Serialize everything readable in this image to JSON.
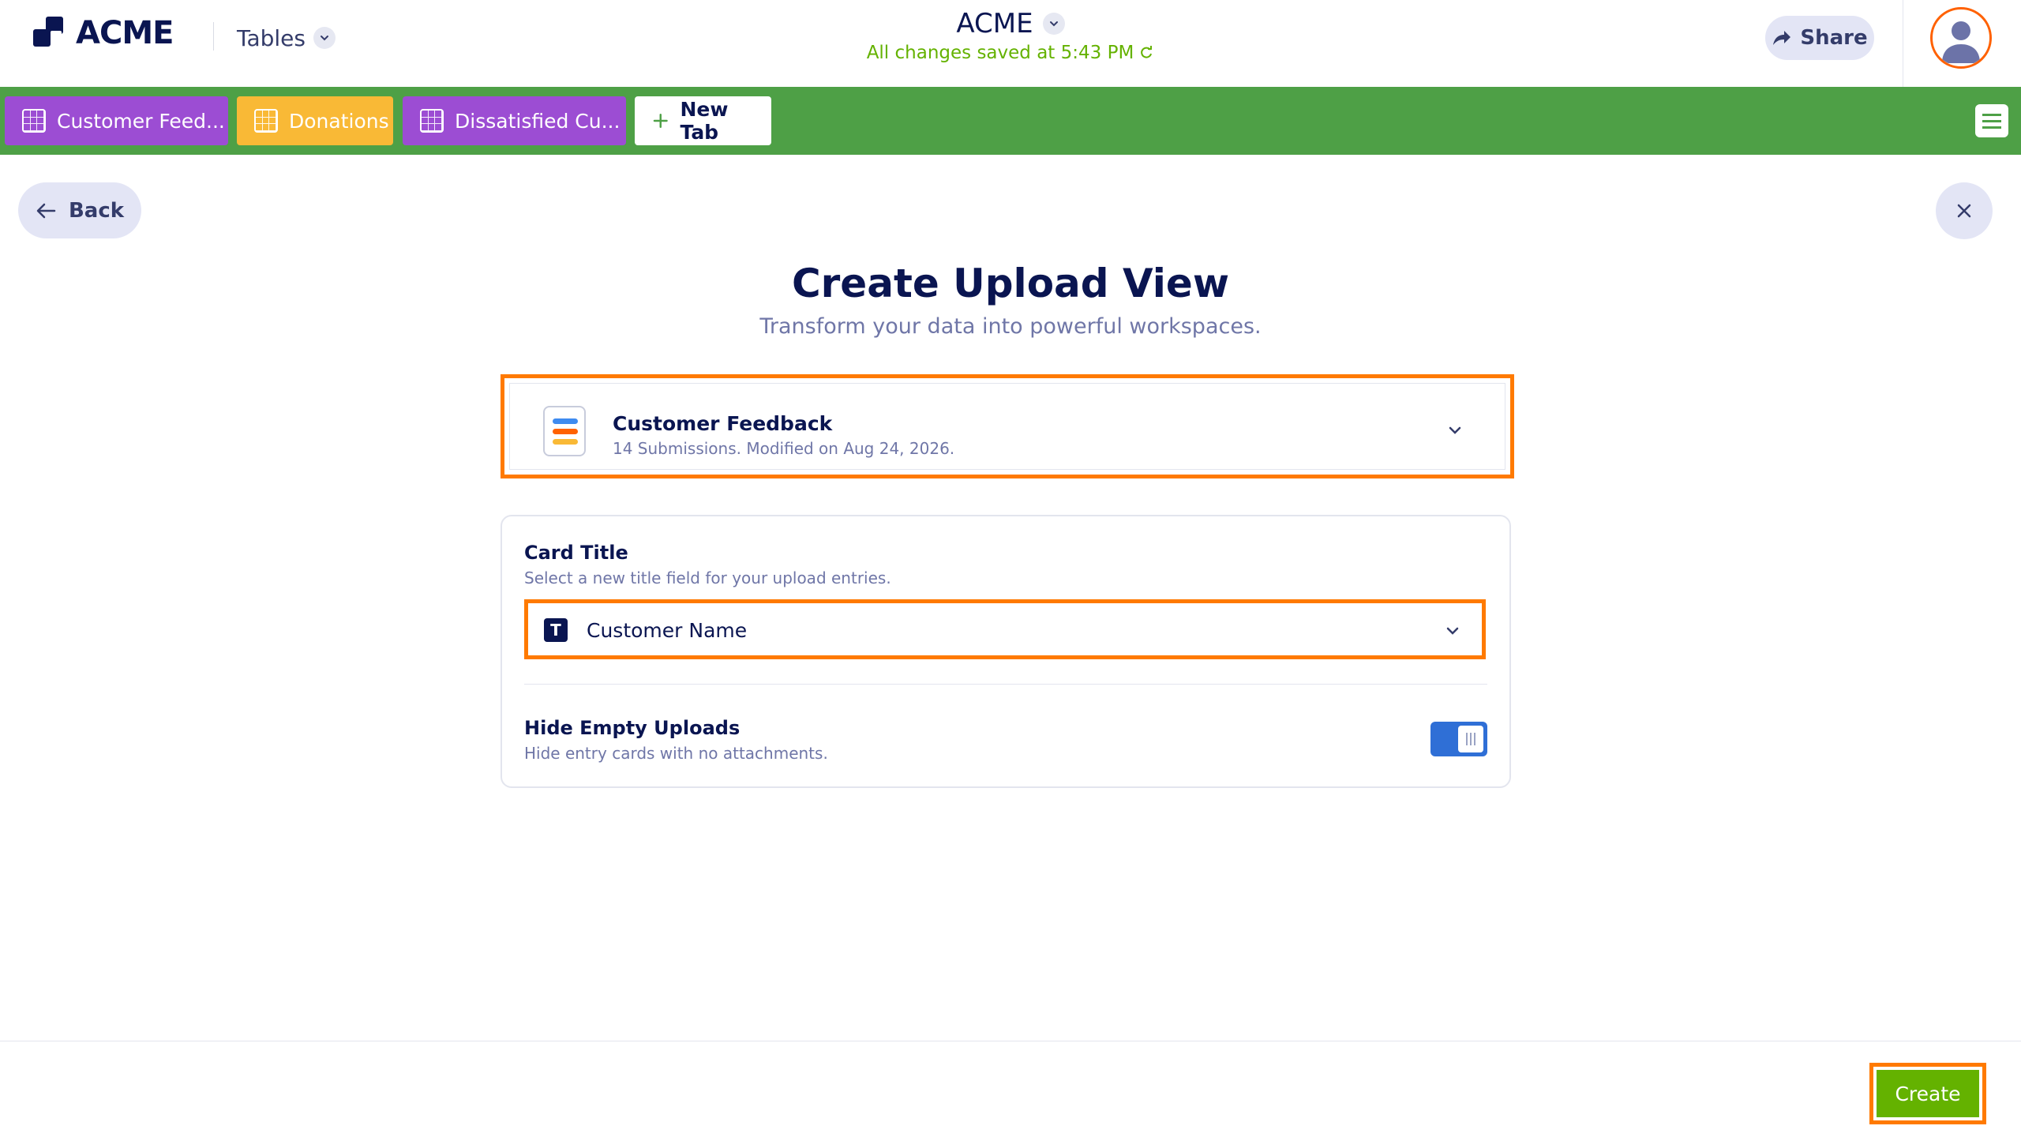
{
  "header": {
    "logo_text": "ACME",
    "product_menu": "Tables",
    "app_title": "ACME",
    "save_status": "All changes saved at 5:43 PM",
    "share_label": "Share"
  },
  "tabs": [
    {
      "label": "Customer Feed...",
      "color": "#9c4dd3"
    },
    {
      "label": "Donations",
      "color": "#f9b936"
    },
    {
      "label": "Dissatisfied Cu...",
      "color": "#9c4dd3"
    },
    {
      "label": "New Tab"
    }
  ],
  "nav": {
    "back_label": "Back"
  },
  "page": {
    "title": "Create Upload View",
    "subtitle": "Transform your data into powerful workspaces."
  },
  "source": {
    "name": "Customer Feedback",
    "meta": "14 Submissions. Modified on Aug 24, 2026."
  },
  "card_title": {
    "heading": "Card Title",
    "description": "Select a new title field for your upload entries.",
    "field_icon_letter": "T",
    "selected_field": "Customer Name"
  },
  "hide_empty": {
    "heading": "Hide Empty Uploads",
    "description": "Hide entry cards with no attachments.",
    "enabled": true
  },
  "footer": {
    "create_label": "Create"
  },
  "colors": {
    "accent_green": "#4ea046",
    "highlight_orange": "#ff7a00",
    "create_green": "#64b200",
    "toggle_blue": "#2f6fd6"
  }
}
